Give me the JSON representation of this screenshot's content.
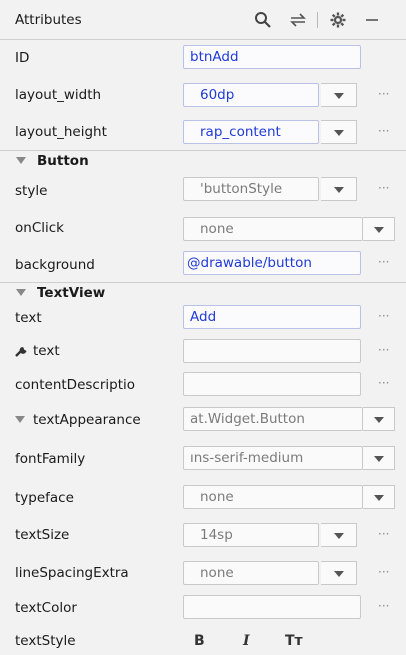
{
  "header": {
    "title": "Attributes"
  },
  "rows": {
    "id": {
      "label": "ID",
      "value": "btnAdd"
    },
    "layout_width": {
      "label": "layout_width",
      "value": "60dp"
    },
    "layout_height": {
      "label": "layout_height",
      "value": "rap_content"
    },
    "style": {
      "label": "style",
      "value": "'buttonStyle"
    },
    "onclick": {
      "label": "onClick",
      "value": "none"
    },
    "background": {
      "label": "background",
      "value": "@drawable/button"
    },
    "text": {
      "label": "text",
      "value": "Add"
    },
    "tools_text": {
      "label": "text",
      "value": ""
    },
    "content_description": {
      "label": "contentDescriptio",
      "value": ""
    },
    "text_appearance": {
      "label": "textAppearance",
      "value": "at.Widget.Button"
    },
    "font_family": {
      "label": "fontFamily",
      "value": "ıns-serif-medium"
    },
    "typeface": {
      "label": "typeface",
      "value": "none"
    },
    "text_size": {
      "label": "textSize",
      "value": "14sp"
    },
    "line_spacing_extra": {
      "label": "lineSpacingExtra",
      "value": "none"
    },
    "text_color": {
      "label": "textColor",
      "value": ""
    },
    "text_style": {
      "label": "textStyle",
      "bold": "B",
      "italic": "I",
      "caps": "Tт"
    }
  },
  "sections": {
    "button": "Button",
    "textview": "TextView"
  },
  "more_dots": "···",
  "icons": {
    "search": "search-icon",
    "swap": "swap-arrows-icon",
    "settings": "gear-icon",
    "minimize": "minimize-icon",
    "wrench": "wrench-icon"
  }
}
